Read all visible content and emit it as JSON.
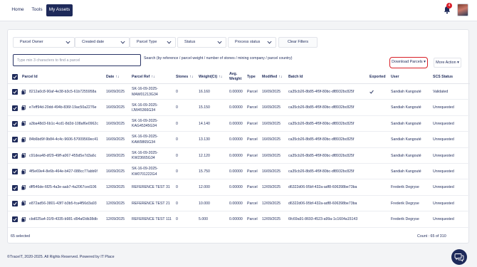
{
  "nav": {
    "home": "Home",
    "tools": "Tools",
    "my_assets": "My Assets",
    "notification_count": "4"
  },
  "filters": {
    "parcel_owner": "Parcel Owner",
    "created_date": "Created date",
    "parcel_type": "Parcel Type",
    "status": "Status",
    "process_status": "Process status",
    "clear": "Clear Filters"
  },
  "search": {
    "placeholder": "Type min 3 characters to find a parcel",
    "hint": "Search (by reference / parcel weight / number of stones / mining company / parcel country)"
  },
  "actions": {
    "download": "Download Parcels ▾",
    "more": "More Action ▾"
  },
  "table": {
    "columns": {
      "parcel_id": "Parcel Id",
      "date": "Date",
      "parcel_ref": "Parcel Ref",
      "stones": "Stones",
      "weight": "Weight(Ct)",
      "avg_weight": "Avg. Weight",
      "type": "Type",
      "modified": "Modified",
      "batch_id": "Batch Id",
      "exported": "Exported",
      "user": "User",
      "scs_status": "SCS Status"
    },
    "rows": [
      {
        "parcel_id": "8212a0c8-90af-4e38-b3c5-61b7255958a",
        "date": "16/09/2025",
        "ref1": "SK-16-09-2025-",
        "ref2": "MAW01213G34",
        "stones": "0",
        "weight": "16.160",
        "avg": "0.00000",
        "type": "Parcel",
        "modified": "16/09/2025",
        "batch": "ca35cb26-8b85-4f9f-80bc-df8932bc825f",
        "exported": true,
        "user": "Sandiah Kangouté",
        "status": "Validated"
      },
      {
        "parcel_id": "e7eff94d-20dd-494b-836f-19ac50a2276e",
        "date": "16/09/2025",
        "ref1": "SK-16-09-2025-",
        "ref2": "IJW45366G34",
        "stones": "0",
        "weight": "15.150",
        "avg": "0.00000",
        "type": "Parcel",
        "modified": "16/09/2025",
        "batch": "ca35cb26-8b85-4f9f-80bc-df8932bc825f",
        "exported": false,
        "user": "Sandiah Kangouté",
        "status": "Unrequested"
      },
      {
        "parcel_id": "a3ba48d3-6b1c-4cd1-8d2d-108af6e0962c",
        "date": "16/09/2025",
        "ref1": "SK-16-09-2025-",
        "ref2": "KAG45345G34",
        "stones": "0",
        "weight": "14.140",
        "avg": "0.00000",
        "type": "Parcel",
        "modified": "16/09/2025",
        "batch": "ca35cb26-8b85-4f9f-80bc-df8932bc825f",
        "exported": false,
        "user": "Sandiah Kangouté",
        "status": "Unrequested"
      },
      {
        "parcel_id": "84b6bd9f-9b84-4c4c-9606-57009569ec41",
        "date": "16/09/2025",
        "ref1": "SK-16-09-2025-",
        "ref2": "KAW9865G34",
        "stones": "0",
        "weight": "13.130",
        "avg": "0.00000",
        "type": "Parcel",
        "modified": "16/09/2025",
        "batch": "ca35cb26-8b85-4f9f-80bc-df8932bc825f",
        "exported": false,
        "user": "Sandiah Kangouté",
        "status": "Unrequested"
      },
      {
        "parcel_id": "c91dea48-df29-49ff-a067-455d5e7d3a6c",
        "date": "16/09/2025",
        "ref1": "SK-16-09-2025-",
        "ref2": "KW23665G34",
        "stones": "0",
        "weight": "12.120",
        "avg": "0.00000",
        "type": "Parcel",
        "modified": "16/09/2025",
        "batch": "ca35cb26-8b85-4f9f-80bc-df8932bc825f",
        "exported": false,
        "user": "Sandiah Kangouté",
        "status": "Unrequested"
      },
      {
        "parcel_id": "4f5e69e4-8e6b-464e-b427-088cc77abb6f",
        "date": "16/09/2025",
        "ref1": "SK-16-09-2025-",
        "ref2": "KW0701222G4",
        "stones": "0",
        "weight": "15.750",
        "avg": "0.00000",
        "type": "Parcel",
        "modified": "16/09/2025",
        "batch": "ca35cb26-8b85-4f9f-80bc-df8932bc825f",
        "exported": false,
        "user": "Sandiah Kangouté",
        "status": "Unrequested"
      },
      {
        "parcel_id": "dff546de-6f25-4a3e-aab7-4a2067ced106",
        "date": "12/09/2025",
        "ref1": "REFERENCE TEST 31",
        "ref2": "",
        "stones": "0",
        "weight": "12.000",
        "avg": "0.00000",
        "type": "Parcel",
        "modified": "12/09/2025",
        "batch": "d6322d06-95bf-432a-adf8-606398be73ba",
        "exported": false,
        "user": "Frederik Degryse",
        "status": "Unrequested"
      },
      {
        "parcel_id": "e872ad56-3801-43f7-b3b5-fca4f56d3a93",
        "date": "12/09/2025",
        "ref1": "REFERENCE TEST 21",
        "ref2": "",
        "stones": "0",
        "weight": "10.000",
        "avg": "0.00000",
        "type": "Parcel",
        "modified": "12/09/2025",
        "batch": "d6322d06-95bf-432a-adf8-606398be73ba",
        "exported": false,
        "user": "Frederik Degryse",
        "status": "Unrequested"
      },
      {
        "parcel_id": "cbd025a4-31f9-4335-b981-d94af2db38db",
        "date": "12/09/2025",
        "ref1": "REFERENCE TEST 111",
        "ref2": "",
        "stones": "0",
        "weight": "5.000",
        "avg": "0.00000",
        "type": "Parcel",
        "modified": "12/09/2025",
        "batch": "6fc69a91-8693-4523-a99a-1c1604a15143",
        "exported": false,
        "user": "Frederik Degryse",
        "status": "Unrequested"
      }
    ]
  },
  "summary": {
    "selected": "65 selected",
    "count": "Count : 65 of 310"
  },
  "footer": {
    "copyright": "©TraceIT, 2020-2025. All Rights Reserved. Powered by IT Place"
  }
}
